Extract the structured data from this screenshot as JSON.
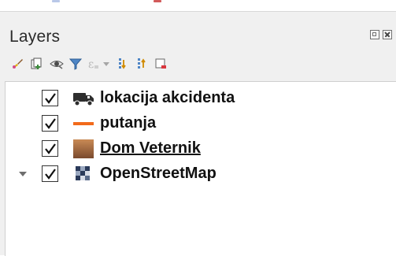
{
  "panel": {
    "title": "Layers",
    "float_icon": "float-panel-icon",
    "close_icon": "close-panel-icon"
  },
  "toolbar": {
    "tools": [
      {
        "name": "style-manager-icon"
      },
      {
        "name": "add-group-icon"
      },
      {
        "name": "manage-visibility-icon"
      },
      {
        "name": "filter-legend-icon"
      },
      {
        "name": "filter-by-expression-icon"
      },
      {
        "name": "dropdown-arrow-icon"
      },
      {
        "name": "expand-all-icon"
      },
      {
        "name": "collapse-all-icon"
      },
      {
        "name": "remove-layer-icon"
      }
    ]
  },
  "layers": [
    {
      "label": "lokacija akcidenta",
      "checked": true,
      "icon": "truck-icon",
      "underlined": false,
      "expandable": false
    },
    {
      "label": "putanja",
      "checked": true,
      "icon": "orange-line-icon",
      "underlined": false,
      "expandable": false
    },
    {
      "label": "Dom Veternik",
      "checked": true,
      "icon": "raster-gradient-icon",
      "underlined": true,
      "expandable": false
    },
    {
      "label": "OpenStreetMap",
      "checked": true,
      "icon": "tile-grid-icon",
      "underlined": false,
      "expandable": true
    }
  ],
  "colors": {
    "line_symbol": "#f26a1b",
    "raster_light": "#c98a55",
    "raster_dark": "#7a4a2e",
    "tile_dark": "#2a3a5a"
  }
}
